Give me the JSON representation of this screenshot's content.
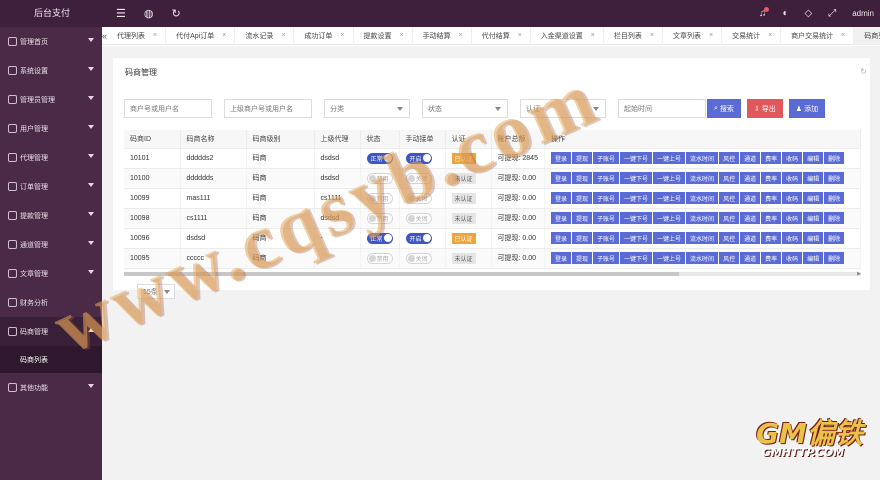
{
  "app": {
    "brand": "后台支付",
    "admin": "admin"
  },
  "sidebar": {
    "items": [
      {
        "label": "管理首页"
      },
      {
        "label": "系统设置"
      },
      {
        "label": "管理员管理"
      },
      {
        "label": "用户管理"
      },
      {
        "label": "代理管理"
      },
      {
        "label": "订单管理"
      },
      {
        "label": "提款管理"
      },
      {
        "label": "通道管理"
      },
      {
        "label": "文章管理"
      },
      {
        "label": "财务分析"
      },
      {
        "label": "码商管理"
      }
    ],
    "sub_item": "码商列表",
    "extra_item": "其他功能"
  },
  "tabs": [
    "代理列表",
    "代付Api订单",
    "流水记录",
    "成功订单",
    "提款设置",
    "手动结算",
    "代付结算",
    "入金渠道设置",
    "栏目列表",
    "文章列表",
    "交易统计",
    "商户交易统计",
    "码商列表"
  ],
  "card": {
    "title": "码商管理",
    "filters": {
      "merchant_placeholder": "商户号或用户名",
      "agent_placeholder": "上级商户号或用户名",
      "category": "分类",
      "status": "状态",
      "auth": "认证",
      "start_time": "起始时间"
    },
    "buttons": {
      "search": "搜索",
      "export": "导出",
      "add": "添加"
    }
  },
  "table": {
    "headers": [
      "码商ID",
      "码商名称",
      "码商级别",
      "上级代理",
      "状态",
      "手动接单",
      "认证",
      "账户总额",
      "操作"
    ],
    "rows": [
      {
        "id": "10101",
        "name": "ddddds2",
        "level": "码商",
        "agent": "dsdsd",
        "status": "正常",
        "manual": "开启",
        "auth": "已认证",
        "balance": "可提现: 2845"
      },
      {
        "id": "10100",
        "name": "dddddds",
        "level": "码商",
        "agent": "dsdsd",
        "status": "禁用",
        "manual": "关闭",
        "auth": "未认证",
        "balance": "可提现: 0.00"
      },
      {
        "id": "10099",
        "name": "mas111",
        "level": "码商",
        "agent": "cs1111",
        "status": "禁用",
        "manual": "关闭",
        "auth": "未认证",
        "balance": "可提现: 0.00"
      },
      {
        "id": "10098",
        "name": "cs1111",
        "level": "码商",
        "agent": "dsdsd",
        "status": "禁用",
        "manual": "关闭",
        "auth": "未认证",
        "balance": "可提现: 0.00"
      },
      {
        "id": "10096",
        "name": "dsdsd",
        "level": "码商",
        "agent": "-",
        "status": "正常",
        "manual": "开启",
        "auth": "已认证",
        "balance": "可提现: 0.00"
      },
      {
        "id": "10095",
        "name": "ccccc",
        "level": "码商",
        "agent": "",
        "status": "禁用",
        "manual": "关闭",
        "auth": "未认证",
        "balance": "可提现: 0.00"
      }
    ],
    "actions": [
      "登录",
      "提现",
      "子账号",
      "一键下号",
      "一键上号",
      "流水时间",
      "风控",
      "通道",
      "费率",
      "收码",
      "编辑",
      "删除"
    ]
  },
  "pager": {
    "page_size": "15条"
  },
  "watermark": {
    "text": "www.cqsyb.com",
    "logo_top": "GM偏铁",
    "logo_bottom": "GMHTTP.COM"
  },
  "colors": {
    "sidebar": "#4a2a47",
    "topbar": "#3e1f3c",
    "primary": "#5b6bd6",
    "danger": "#e0585b",
    "warning": "#f0a53a"
  }
}
